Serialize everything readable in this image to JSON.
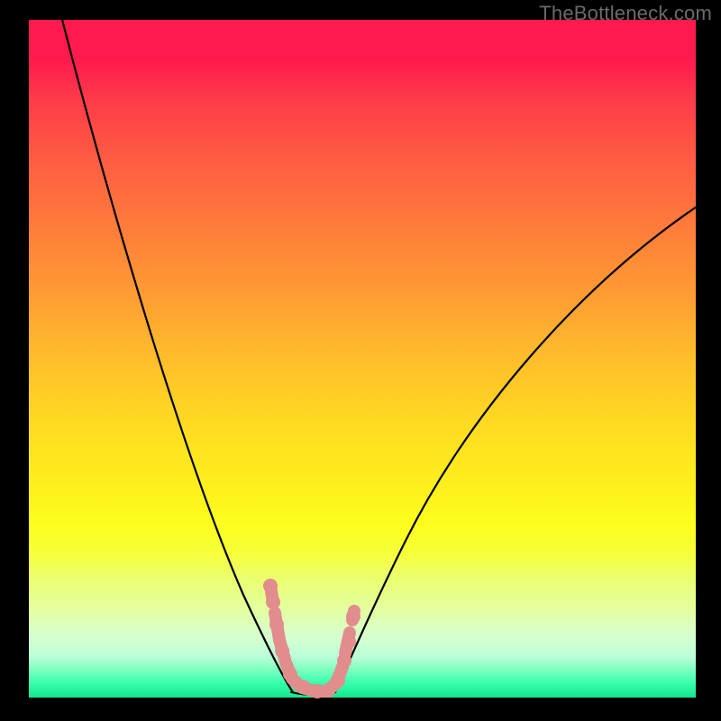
{
  "watermark": "TheBottleneck.com",
  "chart_data": {
    "type": "line",
    "title": "",
    "xlabel": "",
    "ylabel": "",
    "xlim": [
      0,
      100
    ],
    "ylim": [
      0,
      100
    ],
    "grid": false,
    "legend": false,
    "annotations": [],
    "background_gradient": {
      "top_color": "#ff1a4e",
      "bottom_color": "#14e58f",
      "meaning": "bottleneck severity (red high, green low)"
    },
    "series": [
      {
        "name": "left-curve",
        "color": "#000000",
        "x": [
          5,
          8,
          12,
          16,
          20,
          24,
          27,
          30,
          33,
          35,
          37,
          38.5,
          39.5
        ],
        "values": [
          100,
          88,
          74,
          61,
          49,
          38,
          30,
          22,
          15,
          10,
          6,
          3,
          1
        ]
      },
      {
        "name": "right-curve",
        "color": "#000000",
        "x": [
          46,
          48,
          51,
          55,
          60,
          66,
          72,
          78,
          85,
          92,
          100
        ],
        "values": [
          1,
          4,
          9,
          16,
          24,
          33,
          42,
          50,
          58,
          65,
          72
        ]
      },
      {
        "name": "markers-left",
        "type": "scatter",
        "color": "#e28d8d",
        "x": [
          36.5,
          37.0,
          37.8,
          38.6,
          40.0,
          41.5,
          43.0
        ],
        "values": [
          16.0,
          13.5,
          8.5,
          5.0,
          2.0,
          1.0,
          1.0
        ]
      },
      {
        "name": "markers-right",
        "type": "scatter",
        "color": "#e28d8d",
        "x": [
          44.5,
          46.0,
          47.0,
          47.6,
          48.0
        ],
        "values": [
          1.3,
          2.3,
          5.5,
          9.0,
          12.2
        ]
      }
    ],
    "optimal_range": {
      "x_start": 39.5,
      "x_end": 46,
      "value": 0
    }
  }
}
